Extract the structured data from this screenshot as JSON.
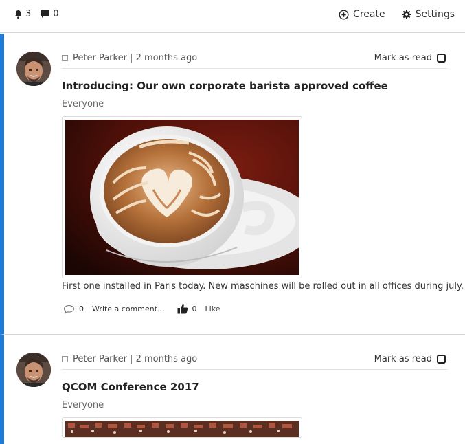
{
  "topbar": {
    "notifications_count": "3",
    "messages_count": "0",
    "create_label": "Create",
    "settings_label": "Settings"
  },
  "posts": [
    {
      "meta_text": "Peter Parker | 2 months ago",
      "mark_read_label": "Mark as read",
      "title": "Introducing: Our own corporate barista approved coffee",
      "audience": "Everyone",
      "body": "First one installed in Paris today. New maschines will be rolled out in all offices during july.",
      "comments_count": "0",
      "comment_label": "Write a comment...",
      "likes_count": "0",
      "like_label": "Like"
    },
    {
      "meta_text": "Peter Parker | 2 months ago",
      "mark_read_label": "Mark as read",
      "title": "QCOM Conference 2017",
      "audience": "Everyone"
    }
  ],
  "colors": {
    "accent": "#1e7bd6",
    "divider": "#d4d4d4"
  },
  "icons": [
    "bell-icon",
    "chat-icon",
    "plus-circle-icon",
    "gear-icon",
    "comment-icon",
    "thumbs-up-icon",
    "checkbox-icon"
  ]
}
